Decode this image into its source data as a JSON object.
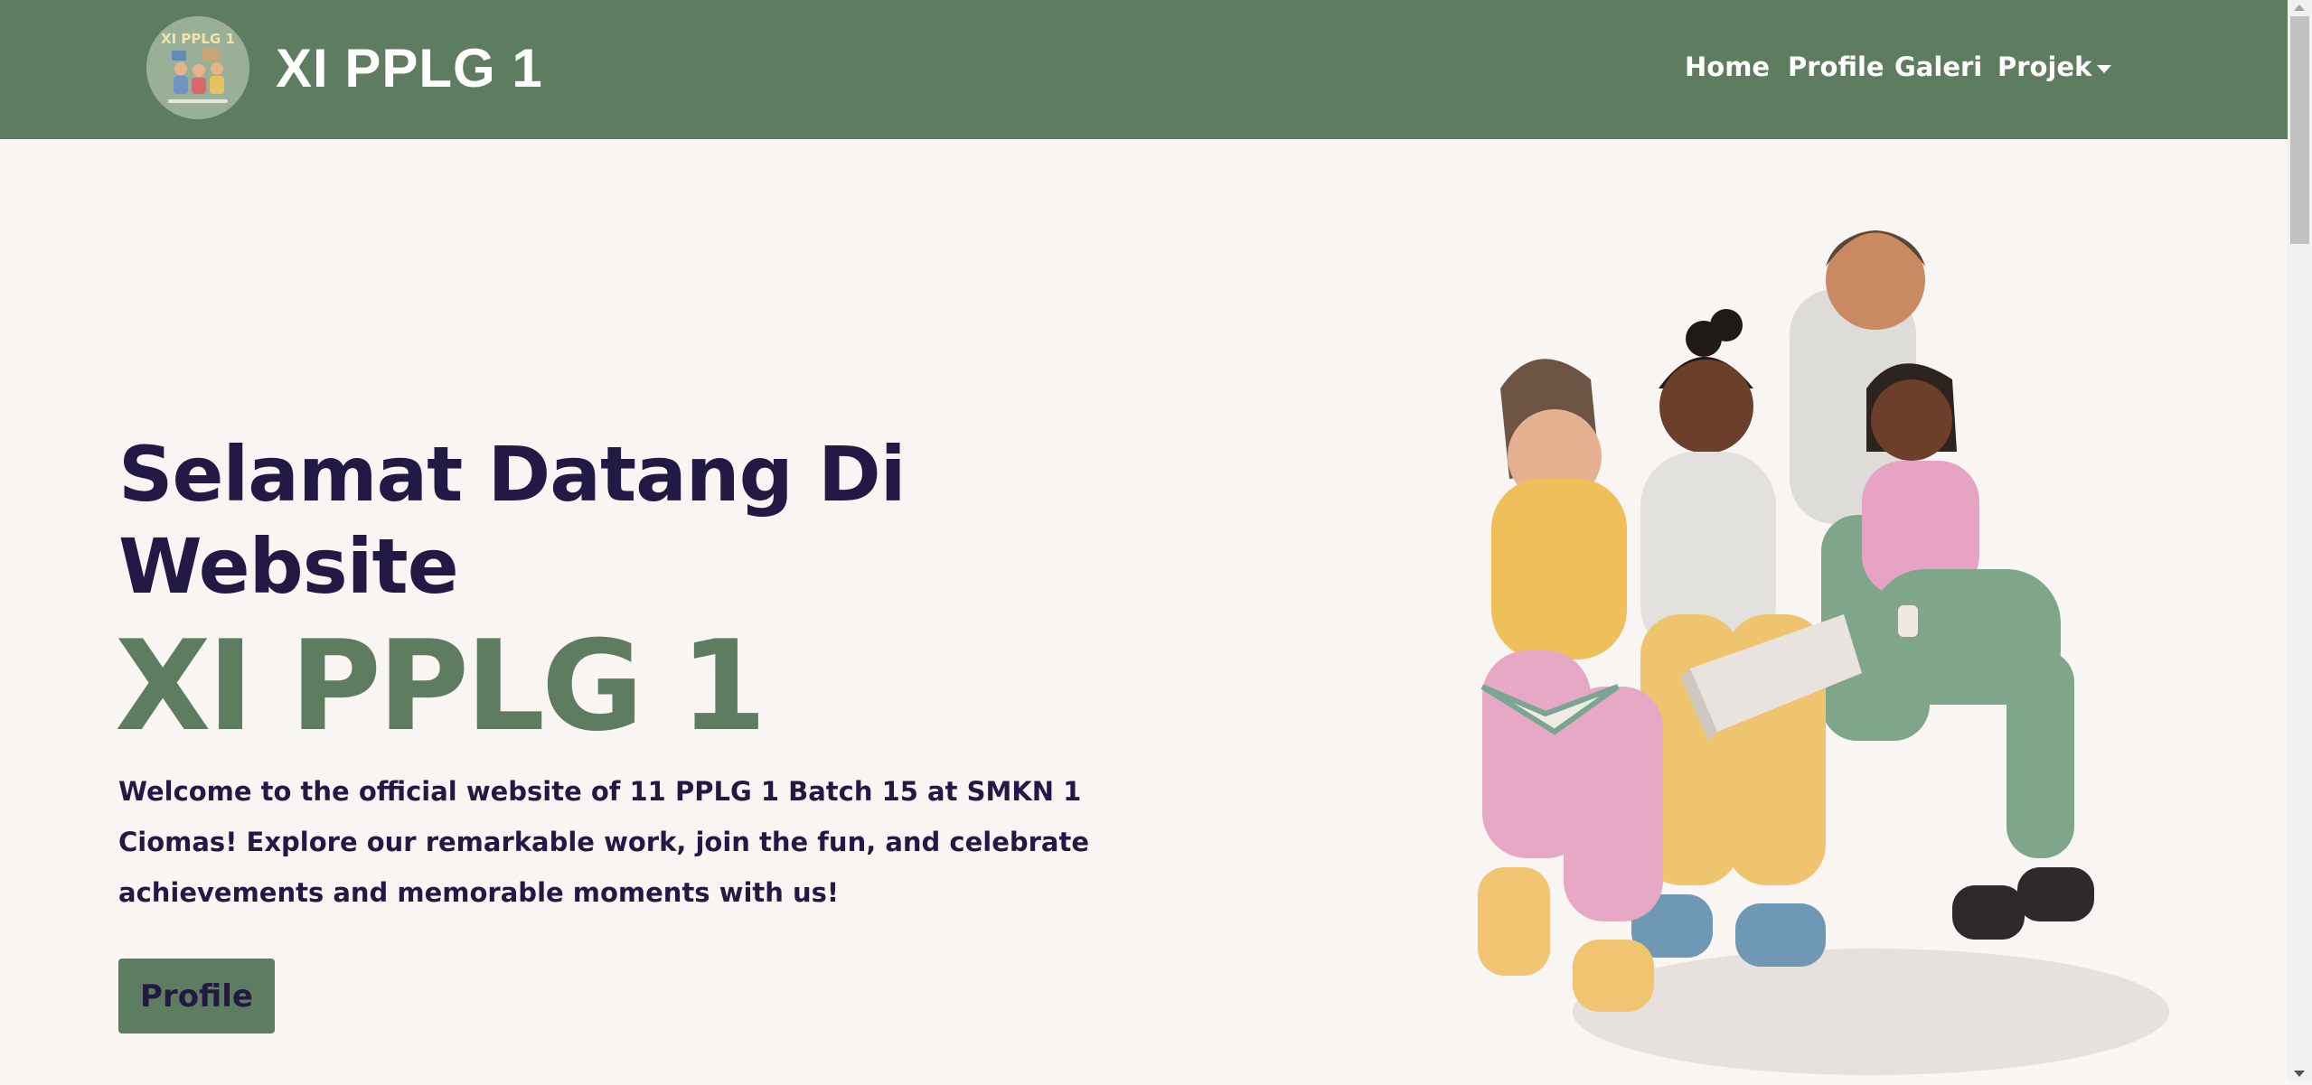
{
  "navbar": {
    "brand_title": "XI PPLG 1",
    "logo_text": "XI PPLG 1",
    "links": [
      {
        "label": "Home"
      },
      {
        "label": "Profile"
      },
      {
        "label": "Galeri"
      },
      {
        "label": "Projek",
        "has_dropdown": true
      }
    ]
  },
  "hero": {
    "heading_line1": "Selamat Datang Di",
    "heading_line2": "Website",
    "class_name": "XI PPLG 1",
    "description": "Welcome to the official website of 11 PPLG 1 Batch 15 at SMKN 1 Ciomas! Explore our remarkable work, join the fun, and celebrate achievements and memorable moments with us!",
    "button_label": "Profile"
  },
  "illustration": {
    "icon": "students-studying-illustration"
  },
  "colors": {
    "navbar_bg": "#5e7d60",
    "page_bg": "#f8f5f2",
    "heading_text": "#221a45",
    "accent_green": "#5e7d60"
  }
}
